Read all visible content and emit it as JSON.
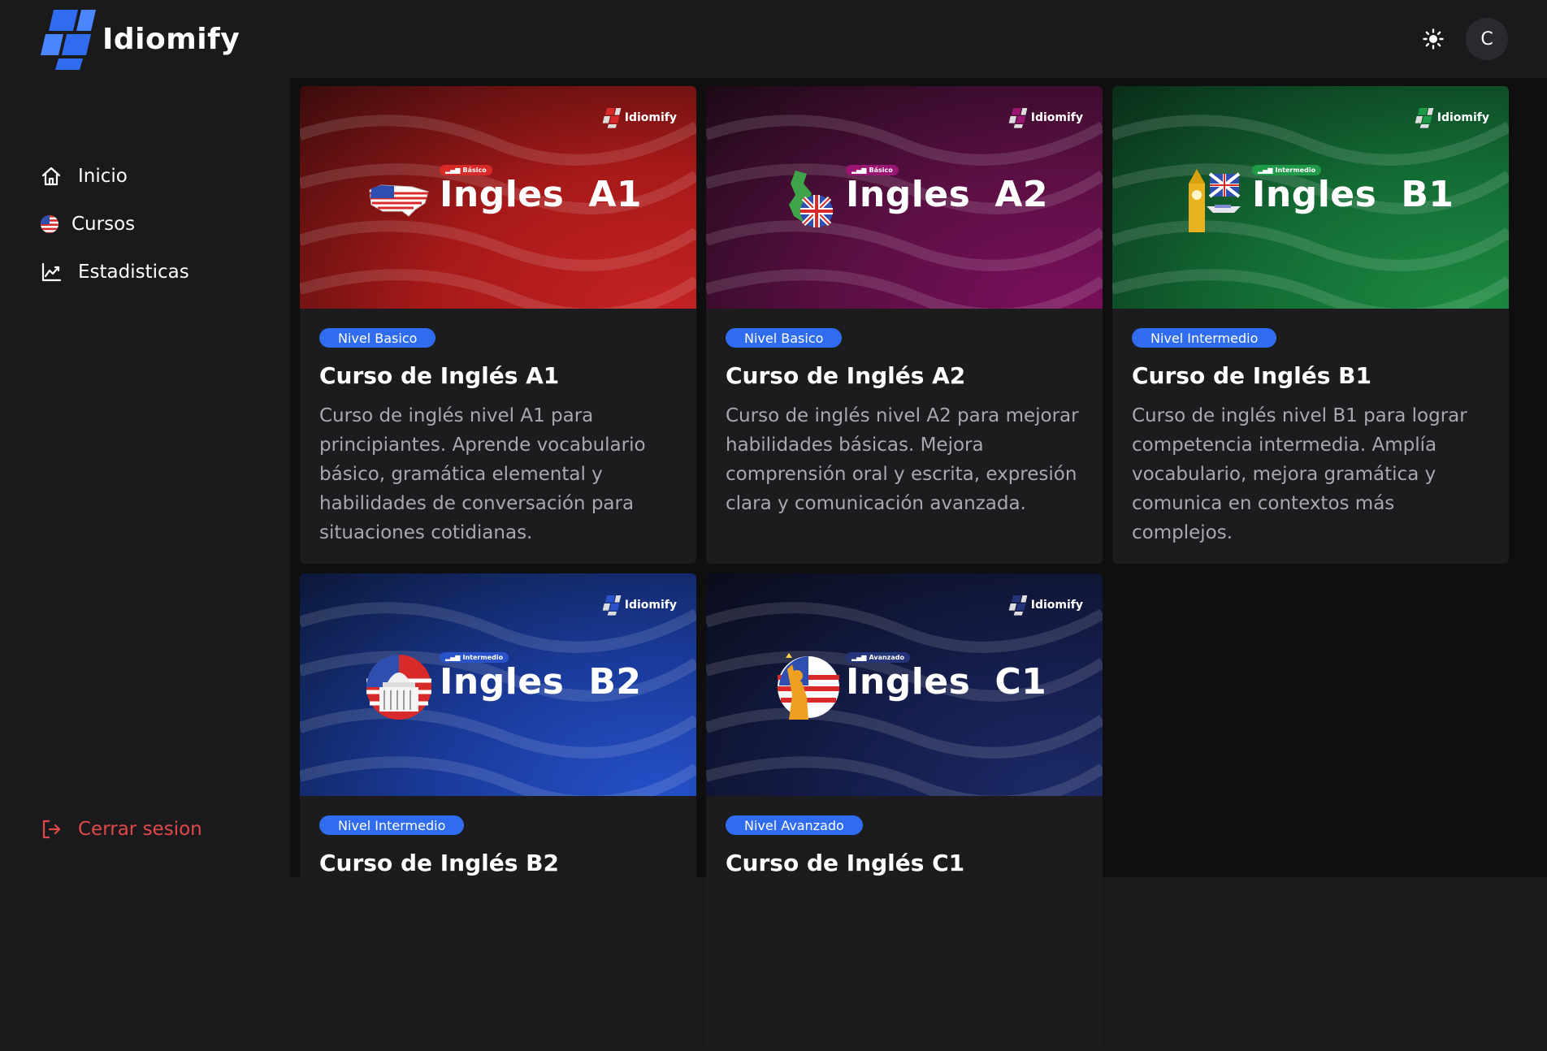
{
  "app": {
    "name": "Idiomify"
  },
  "header": {
    "avatar_initial": "C"
  },
  "sidebar": {
    "items": [
      {
        "label": "Inicio",
        "icon": "home-icon"
      },
      {
        "label": "Cursos",
        "icon": "us-flag-icon"
      },
      {
        "label": "Estadisticas",
        "icon": "chart-line-icon"
      }
    ],
    "logout_label": "Cerrar sesion"
  },
  "courses": [
    {
      "banner_word": "Ingles",
      "banner_level": "A1",
      "banner_chip": "Básico",
      "banner_brand": "Idiomify",
      "badge": "Nivel Basico",
      "title": "Curso de Inglés A1",
      "description": "Curso de inglés nivel A1 para principiantes. Aprende vocabulario básico, gramática elemental y habilidades de conversación para situaciones cotidianas.",
      "banner_colors": [
        "#3a0c0c",
        "#a71919",
        "#c42222"
      ],
      "chip_color": "#d92a2a",
      "icon": "us-map-icon"
    },
    {
      "banner_word": "Ingles",
      "banner_level": "A2",
      "banner_chip": "Básico",
      "banner_brand": "Idiomify",
      "badge": "Nivel Basico",
      "title": "Curso de Inglés A2",
      "description": "Curso de inglés nivel A2 para mejorar habilidades básicas. Mejora comprensión oral y escrita, expresión clara y comunicación avanzada.",
      "banner_colors": [
        "#1c0a16",
        "#5a0f43",
        "#7a0f5c"
      ],
      "chip_color": "#9b1572",
      "icon": "uk-map-icon"
    },
    {
      "banner_word": "Ingles",
      "banner_level": "B1",
      "banner_chip": "Intermedio",
      "banner_brand": "Idiomify",
      "badge": "Nivel Intermedio",
      "title": "Curso de Inglés B1",
      "description": "Curso de inglés nivel B1 para lograr competencia intermedia. Amplía vocabulario, mejora gramática y comunica en contextos más complejos.",
      "banner_colors": [
        "#0a2d18",
        "#136b34",
        "#1c8a40"
      ],
      "chip_color": "#1f9a48",
      "icon": "big-ben-icon"
    },
    {
      "banner_word": "Ingles",
      "banner_level": "B2",
      "banner_chip": "Intermedio",
      "banner_brand": "Idiomify",
      "badge": "Nivel Intermedio",
      "title": "Curso de Inglés B2",
      "description": "",
      "banner_colors": [
        "#0c1838",
        "#1a3a99",
        "#2450c8"
      ],
      "chip_color": "#2a52c9",
      "icon": "capitol-icon"
    },
    {
      "banner_word": "Ingles",
      "banner_level": "C1",
      "banner_chip": "Avanzado",
      "banner_brand": "Idiomify",
      "badge": "Nivel Avanzado",
      "title": "Curso de Inglés C1",
      "description": "",
      "banner_colors": [
        "#0a0c1a",
        "#141d4a",
        "#1c2a66"
      ],
      "chip_color": "#25357a",
      "icon": "liberty-icon"
    }
  ]
}
